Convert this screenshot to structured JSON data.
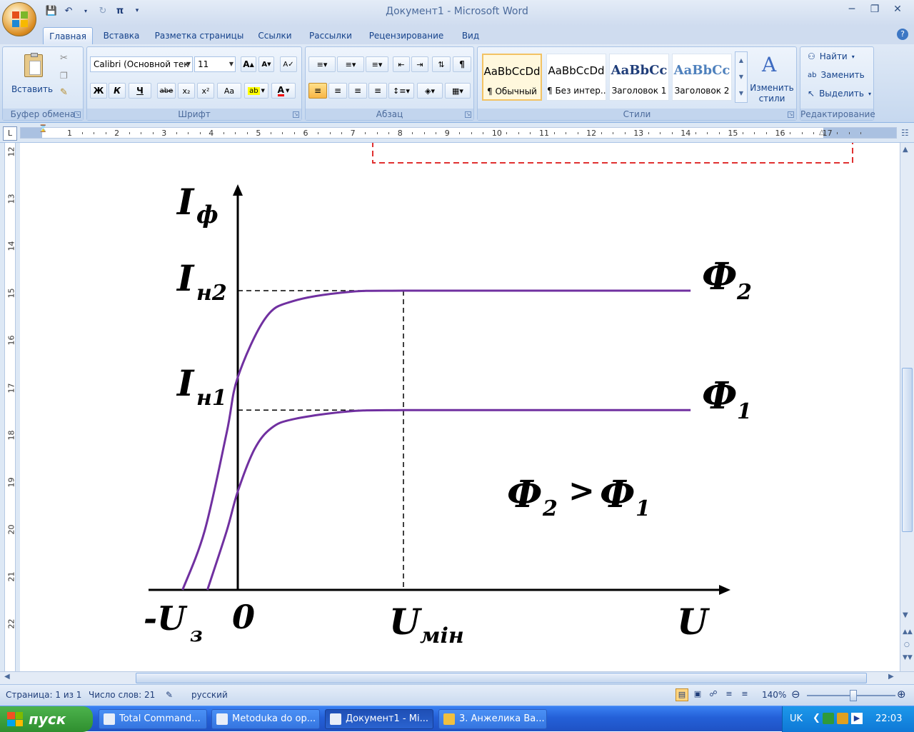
{
  "window": {
    "title": "Документ1 - Microsoft Word"
  },
  "qat": {
    "icons": [
      "save-icon",
      "undo-icon",
      "redo-icon",
      "pi-icon"
    ]
  },
  "tabs": [
    {
      "label": "Главная",
      "active": true
    },
    {
      "label": "Вставка"
    },
    {
      "label": "Разметка страницы"
    },
    {
      "label": "Ссылки"
    },
    {
      "label": "Рассылки"
    },
    {
      "label": "Рецензирование"
    },
    {
      "label": "Вид"
    }
  ],
  "ribbon": {
    "clipboard": {
      "label": "Буфер обмена",
      "paste_label": "Вставить"
    },
    "font": {
      "label": "Шрифт",
      "font_name": "Calibri (Основной тек",
      "font_size": "11",
      "buttons": [
        "Ж",
        "К",
        "Ч",
        "abe",
        "x₂",
        "x²",
        "Aa"
      ]
    },
    "paragraph": {
      "label": "Абзац"
    },
    "styles": {
      "label": "Стили",
      "change_label": "Изменить стили",
      "items": [
        {
          "sample": "AaBbCcDd",
          "name": "¶ Обычный"
        },
        {
          "sample": "AaBbCcDd",
          "name": "¶ Без интер..."
        },
        {
          "sample": "AaBbCc",
          "name": "Заголовок 1"
        },
        {
          "sample": "AaBbCc",
          "name": "Заголовок 2"
        }
      ]
    },
    "editing": {
      "label": "Редактирование",
      "find": "Найти",
      "replace": "Заменить",
      "select": "Выделить"
    }
  },
  "ruler": {
    "h_numbers": [
      "1",
      "2",
      "3",
      "4",
      "5",
      "6",
      "7",
      "8",
      "9",
      "10",
      "11",
      "12",
      "13",
      "14",
      "15",
      "16",
      "17"
    ],
    "v_numbers": [
      "12",
      "13",
      "14",
      "15",
      "16",
      "17",
      "18",
      "19",
      "20",
      "21",
      "22"
    ]
  },
  "chart_data": {
    "type": "line",
    "xlabel": "U",
    "ylabel": "Iф",
    "x_ticks": [
      "-Uз",
      "0",
      "Uмін"
    ],
    "y_ticks": [
      "Iн2",
      "Iн1"
    ],
    "series": [
      {
        "name": "Ф2",
        "x": [
          -1.0,
          -0.6,
          -0.2,
          0,
          0.5,
          1.0,
          2.0,
          3.0,
          5.0
        ],
        "y": [
          0,
          0.45,
          1.2,
          1.62,
          2.07,
          2.2,
          2.27,
          2.28,
          2.28
        ]
      },
      {
        "name": "Ф1",
        "x": [
          -0.55,
          -0.2,
          0,
          0.3,
          0.6,
          1.0,
          2.0,
          3.0,
          5.0
        ],
        "y": [
          0,
          0.45,
          0.75,
          1.07,
          1.23,
          1.3,
          1.36,
          1.37,
          1.37
        ]
      }
    ],
    "annotation": "Ф2 > Ф1"
  },
  "status": {
    "page": "Страница: 1 из 1",
    "words": "Число слов: 21",
    "language": "русский",
    "zoom": "140%"
  },
  "taskbar": {
    "start": "пуск",
    "tasks": [
      {
        "label": "Total Command..."
      },
      {
        "label": "Metoduka do op..."
      },
      {
        "label": "Документ1 - Mi...",
        "active": true
      },
      {
        "label": "3. Анжелика Ва..."
      }
    ],
    "tray": {
      "lang": "UK",
      "clock": "22:03"
    }
  }
}
